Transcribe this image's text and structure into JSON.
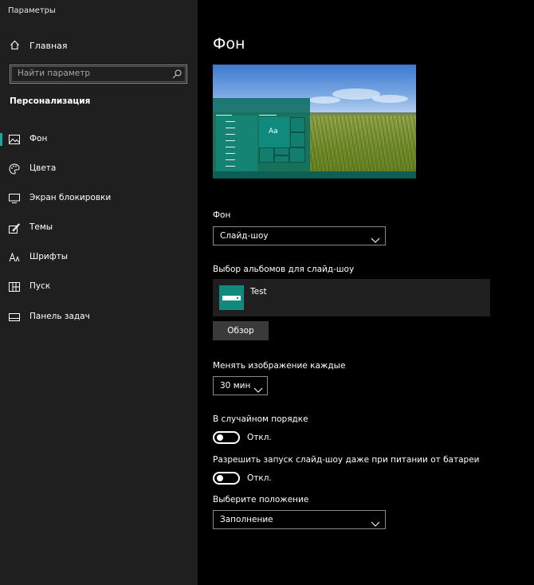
{
  "window": {
    "title": "Параметры"
  },
  "sidebar": {
    "home_label": "Главная",
    "search_placeholder": "Найти параметр",
    "section_title": "Персонализация",
    "items": [
      {
        "label": "Фон",
        "icon": "picture-icon",
        "active": true
      },
      {
        "label": "Цвета",
        "icon": "palette-icon",
        "active": false
      },
      {
        "label": "Экран блокировки",
        "icon": "monitor-icon",
        "active": false
      },
      {
        "label": "Темы",
        "icon": "themes-icon",
        "active": false
      },
      {
        "label": "Шрифты",
        "icon": "font-icon",
        "active": false
      },
      {
        "label": "Пуск",
        "icon": "start-icon",
        "active": false
      },
      {
        "label": "Панель задач",
        "icon": "taskbar-icon",
        "active": false
      }
    ]
  },
  "main": {
    "title": "Фон",
    "background": {
      "label": "Фон",
      "value": "Слайд-шоу"
    },
    "albums": {
      "label": "Выбор альбомов для слайд-шоу",
      "album_name": "Test",
      "browse_label": "Обзор"
    },
    "interval": {
      "label": "Менять изображение каждые",
      "value": "30 мин"
    },
    "shuffle": {
      "label": "В случайном порядке",
      "state": "Откл."
    },
    "battery": {
      "label": "Разрешить запуск слайд-шоу даже при питании от батареи",
      "state": "Откл."
    },
    "fit": {
      "label": "Выберите положение",
      "value": "Заполнение"
    }
  },
  "preview": {
    "tile_text": "Aa",
    "accent_color": "#0f8a7c"
  },
  "colors": {
    "sidebar_bg": "#1f1f1f",
    "main_bg": "#000000",
    "accent": "#1fa3a3"
  }
}
